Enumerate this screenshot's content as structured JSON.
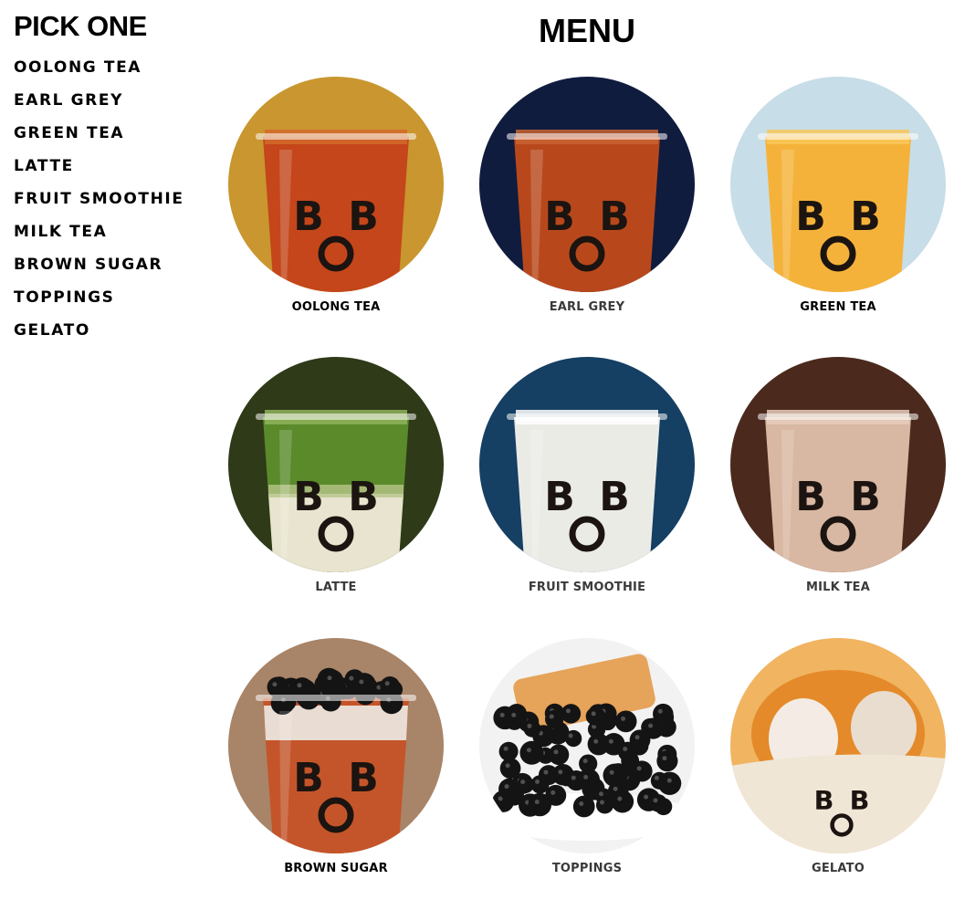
{
  "sidebar": {
    "title": "PICK ONE",
    "items": [
      "OOLONG TEA",
      "EARL GREY",
      "GREEN TEA",
      "LATTE",
      "FRUIT SMOOTHIE",
      "MILK TEA",
      "BROWN SUGAR",
      "TOPPINGS",
      "GELATO"
    ]
  },
  "menu": {
    "title": "MENU",
    "items": [
      {
        "label": "OOLONG TEA",
        "bg": "#c9962f",
        "drink": "#c4461a",
        "cup_top": "#d46a2a"
      },
      {
        "label": "EARL GREY",
        "bg": "#101c3e",
        "drink": "#b8481c",
        "cup_top": "#c96330"
      },
      {
        "label": "GREEN TEA",
        "bg": "#c7dde8",
        "drink": "#f5b23a",
        "cup_top": "#f8c75a"
      },
      {
        "label": "LATTE",
        "bg": "#2e3a18",
        "drink": "#5a8a2a",
        "cup_top": "#8fb35a"
      },
      {
        "label": "FRUIT SMOOTHIE",
        "bg": "#153f63",
        "drink": "#ebebe6",
        "cup_top": "#ffffff"
      },
      {
        "label": "MILK TEA",
        "bg": "#4b2a1d",
        "drink": "#d8b8a2",
        "cup_top": "#e6cdbb"
      },
      {
        "label": "BROWN SUGAR",
        "bg": "#a88468",
        "drink": "#c4552a",
        "cup_top": "#e9dcd2"
      },
      {
        "label": "TOPPINGS",
        "bg": "#f2f2f2",
        "drink": "#1a1a1a",
        "cup_top": "#1a1a1a"
      },
      {
        "label": "GELATO",
        "bg": "#f1b461",
        "drink": "#e48a2a",
        "cup_top": "#f0e6d6"
      }
    ]
  },
  "logo_text": {
    "b": "B",
    "o": "O"
  }
}
